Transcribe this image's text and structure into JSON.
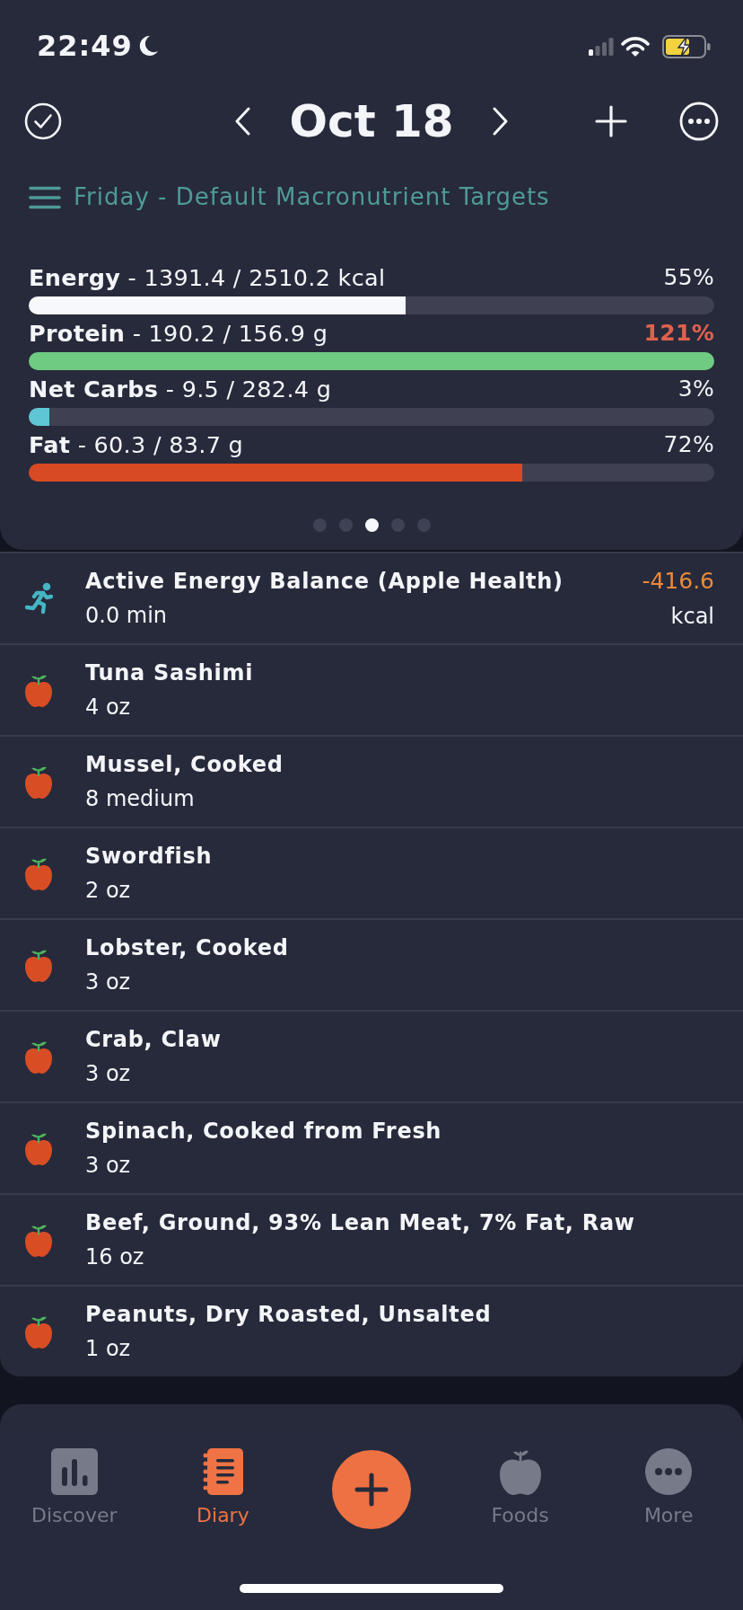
{
  "status_bar": {
    "time": "22:49"
  },
  "header": {
    "title": "Oct 18"
  },
  "targets": {
    "label": "Friday - Default Macronutrient Targets"
  },
  "macros": [
    {
      "label": "**Energy** - 1391.4 / 2510.2 kcal",
      "percent": "55%",
      "over": false,
      "level": 0.55,
      "color": "#f7f8fc"
    },
    {
      "label": "**Protein** - 190.2 / 156.9 g",
      "percent": "121%",
      "over": true,
      "level": 1,
      "color": "#6fcb82"
    },
    {
      "label": "**Net Carbs** - 9.5 / 282.4 g",
      "percent": "3%",
      "over": false,
      "level": 0.03,
      "color": "#5ec6d4"
    },
    {
      "label": "**Fat** - 60.3 / 83.7 g",
      "percent": "72%",
      "over": false,
      "level": 0.72,
      "color": "#d74a23"
    }
  ],
  "pager": [
    {
      "selected": false
    },
    {
      "selected": false
    },
    {
      "selected": true
    },
    {
      "selected": false
    },
    {
      "selected": false
    }
  ],
  "entries": [
    {
      "kind": "activity",
      "name": "Active Energy Balance (Apple Health)",
      "detail": "0.0 min",
      "value": "-416.6",
      "unit": "kcal"
    },
    {
      "kind": "food",
      "name": "Tuna Sashimi",
      "detail": "4 oz"
    },
    {
      "kind": "food",
      "name": "Mussel, Cooked",
      "detail": "8 medium"
    },
    {
      "kind": "food",
      "name": "Swordfish",
      "detail": "2 oz"
    },
    {
      "kind": "food",
      "name": "Lobster, Cooked",
      "detail": "3 oz"
    },
    {
      "kind": "food",
      "name": "Crab, Claw",
      "detail": "3 oz"
    },
    {
      "kind": "food",
      "name": "Spinach, Cooked from Fresh",
      "detail": "3 oz"
    },
    {
      "kind": "food",
      "name": "Beef, Ground, 93% Lean Meat, 7% Fat, Raw",
      "detail": "16 oz"
    },
    {
      "kind": "food",
      "name": "Peanuts, Dry Roasted, Unsalted",
      "detail": "1 oz"
    }
  ],
  "tab_bar": [
    {
      "kind": "tab",
      "label": "Discover",
      "selected": false
    },
    {
      "kind": "tab",
      "label": "Diary",
      "selected": true
    },
    {
      "kind": "add"
    },
    {
      "kind": "tab",
      "label": "Foods",
      "selected": false
    },
    {
      "kind": "tab",
      "label": "More",
      "selected": false
    }
  ]
}
